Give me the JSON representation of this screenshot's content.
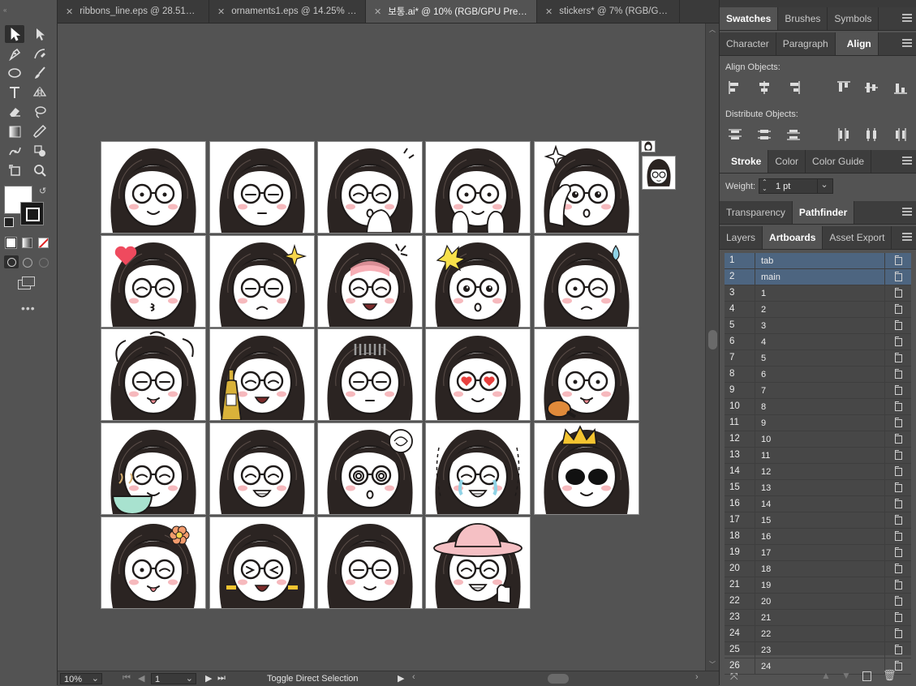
{
  "tabs": [
    {
      "title": "ribbons_line.eps @ 28.51% (R...",
      "active": false
    },
    {
      "title": "ornaments1.eps @ 14.25% (R...",
      "active": false
    },
    {
      "title": "보통.ai* @ 10% (RGB/GPU Preview)",
      "active": true
    },
    {
      "title": "stickers* @ 7% (RGB/GPU Pre...",
      "active": false
    }
  ],
  "toolbar": {
    "tools": [
      "selection-tool-icon",
      "direct-selection-tool-icon",
      "pen-tool-icon",
      "curvature-tool-icon",
      "ellipse-tool-icon",
      "paintbrush-tool-icon",
      "type-tool-icon",
      "reflect-tool-icon",
      "eraser-tool-icon",
      "lasso-tool-icon",
      "gradient-tool-icon",
      "eyedropper-tool-icon",
      "puppet-warp-tool-icon",
      "shape-builder-tool-icon",
      "artboard-tool-icon",
      "zoom-tool-icon"
    ],
    "fill_color": "#ffffff",
    "stroke_color": "#000000"
  },
  "status": {
    "zoom": "10%",
    "artboard_number": "1",
    "tool_hint": "Toggle Direct Selection"
  },
  "panels": {
    "group1_tabs": [
      "Swatches",
      "Brushes",
      "Symbols"
    ],
    "group2_tabs": [
      "Character",
      "Paragraph",
      "Align"
    ],
    "align_objects_label": "Align Objects:",
    "distribute_objects_label": "Distribute Objects:",
    "group3_tabs": [
      "Stroke",
      "Color",
      "Color Guide"
    ],
    "weight_label": "Weight:",
    "weight_value": "1 pt",
    "group4_tabs": [
      "Transparency",
      "Pathfinder"
    ],
    "group5_tabs": [
      "Layers",
      "Artboards",
      "Asset Export"
    ]
  },
  "artboards": [
    {
      "num": "1",
      "name": "tab",
      "selected": true
    },
    {
      "num": "2",
      "name": "main",
      "selected": true
    },
    {
      "num": "3",
      "name": "1"
    },
    {
      "num": "4",
      "name": "2"
    },
    {
      "num": "5",
      "name": "3"
    },
    {
      "num": "6",
      "name": "4"
    },
    {
      "num": "7",
      "name": "5"
    },
    {
      "num": "8",
      "name": "6"
    },
    {
      "num": "9",
      "name": "7"
    },
    {
      "num": "10",
      "name": "8"
    },
    {
      "num": "11",
      "name": "9"
    },
    {
      "num": "12",
      "name": "10"
    },
    {
      "num": "13",
      "name": "11"
    },
    {
      "num": "14",
      "name": "12"
    },
    {
      "num": "15",
      "name": "13"
    },
    {
      "num": "16",
      "name": "14"
    },
    {
      "num": "17",
      "name": "15"
    },
    {
      "num": "18",
      "name": "16"
    },
    {
      "num": "19",
      "name": "17"
    },
    {
      "num": "20",
      "name": "18"
    },
    {
      "num": "21",
      "name": "19"
    },
    {
      "num": "22",
      "name": "20"
    },
    {
      "num": "23",
      "name": "21"
    },
    {
      "num": "24",
      "name": "22"
    },
    {
      "num": "25",
      "name": "23"
    },
    {
      "num": "26",
      "name": "24"
    }
  ],
  "stickers": [
    "smile",
    "neutral",
    "yawn",
    "cheeks-in-hands",
    "salute-sparkle",
    "heart-kiss",
    "sad-sparkle",
    "angry-blush",
    "shocked-burst",
    "wink-sweat",
    "messy-hair",
    "drink-bottle",
    "gloomy",
    "heart-eyes",
    "drumstick-drool",
    "coffee-cup",
    "laughing",
    "dizzy-swirl",
    "crying",
    "sunglasses-crown",
    "flower-tongue",
    "excited-pigtails",
    "smirk",
    "sunhat-thumbs-up"
  ]
}
